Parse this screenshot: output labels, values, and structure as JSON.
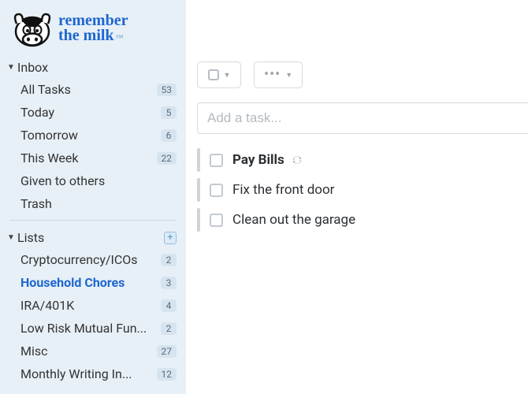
{
  "brand": {
    "line1": "remember",
    "line2": "the milk"
  },
  "sections": {
    "inbox": {
      "title": "Inbox",
      "items": [
        {
          "label": "All Tasks",
          "count": "53"
        },
        {
          "label": "Today",
          "count": "5"
        },
        {
          "label": "Tomorrow",
          "count": "6"
        },
        {
          "label": "This Week",
          "count": "22"
        },
        {
          "label": "Given to others",
          "count": ""
        },
        {
          "label": "Trash",
          "count": ""
        }
      ]
    },
    "lists": {
      "title": "Lists",
      "items": [
        {
          "label": "Cryptocurrency/ICOs",
          "count": "2",
          "selected": false
        },
        {
          "label": "Household Chores",
          "count": "3",
          "selected": true
        },
        {
          "label": "IRA/401K",
          "count": "4",
          "selected": false
        },
        {
          "label": "Low Risk Mutual Fun...",
          "count": "2",
          "selected": false
        },
        {
          "label": "Misc",
          "count": "27",
          "selected": false
        },
        {
          "label": "Monthly Writing In...",
          "count": "12",
          "selected": false
        }
      ]
    }
  },
  "addTask": {
    "placeholder": "Add a task..."
  },
  "tasks": [
    {
      "label": "Pay Bills",
      "bold": true,
      "repeat": true
    },
    {
      "label": "Fix the front door",
      "bold": false,
      "repeat": false
    },
    {
      "label": "Clean out the garage",
      "bold": false,
      "repeat": false
    }
  ]
}
